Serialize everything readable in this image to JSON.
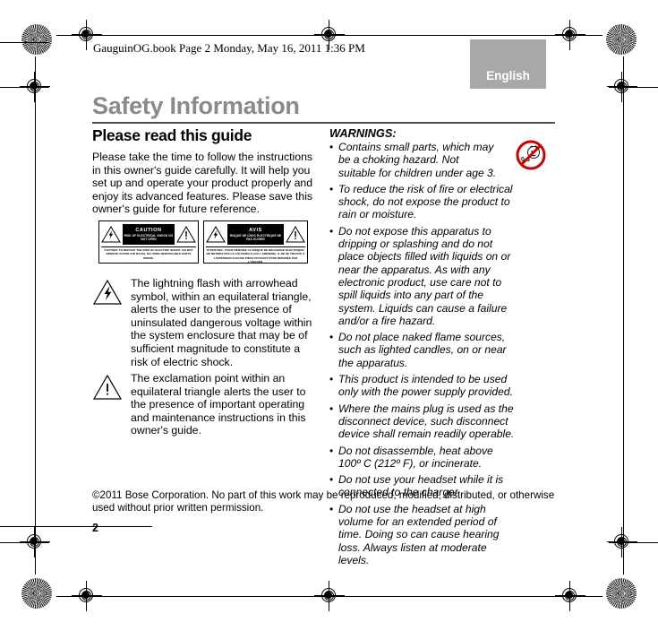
{
  "page_header": "GauguinOG.book  Page 2  Monday, May 16, 2011  1:36 PM",
  "language_tab": "English",
  "document": {
    "title": "Safety Information",
    "page_number": "2",
    "copyright": "©2011 Bose Corporation. No part of this work may be reproduced, modified, distributed, or otherwise used without prior written permission."
  },
  "left_column": {
    "heading": "Please read this guide",
    "intro": "Please take the time to follow the instructions in this owner's guide carefully. It will help you set up and operate your product properly and enjoy its advanced features. Please save this owner's guide for future reference.",
    "notice_boxes": [
      {
        "banner_word": "CAUTION",
        "banner_sub": "RISK OF ELECTRICAL SHOCK DO NOT OPEN",
        "footer": "CAUTION: TO REDUCE THE RISK OF ELECTRIC SHOCK, DO NOT REMOVE COVER (OR BACK), NO USER-SERVICEABLE PARTS INSIDE."
      },
      {
        "banner_word": "AVIS",
        "banner_sub": "RISQUE DE CHOC ELECTRIQUE NE PAS OUVRIR",
        "footer": "ATTENTION : POUR RÉDUIRE LE RISQUE DE DÉCHARGE ÉLECTRIQUE, NE RETIREZ PAS LE COUVERCLE (OU L'ARRIÈRE). IL NE SE TROUVE À L'INTÉRIEUR AUCUNE PIÈCE POUVANT ÊTRE RÉPARÉE PAR L'USAGER."
      }
    ],
    "symbols": [
      {
        "icon": "lightning-bolt-triangle-icon",
        "text": "The lightning flash with arrowhead symbol, within an equilateral triangle, alerts the user to the presence of uninsulated dangerous voltage within the system enclosure that may be of sufficient magnitude to constitute a risk of electric shock."
      },
      {
        "icon": "exclamation-triangle-icon",
        "text": "The exclamation point within an equilateral triangle alerts the user to the presence of important operating and maintenance instructions in this owner's guide."
      }
    ]
  },
  "right_column": {
    "heading": "WARNINGS:",
    "choking_icon_label": "0-3",
    "warnings": [
      "Contains small parts, which may be a choking hazard. Not suitable for children under age 3.",
      "To reduce the risk of fire or electrical shock, do not expose the product to rain or moisture.",
      "Do not expose this apparatus to dripping or splashing and do not place objects filled with liquids on or near the apparatus. As with any electronic product, use care not to spill liquids into any part of the system. Liquids can cause a failure and/or a fire hazard.",
      "Do not place naked flame sources, such as lighted candles, on or near the apparatus.",
      "This product is intended to be used only with the power supply provided.",
      "Where the mains plug is used as the disconnect device, such disconnect device shall remain readily operable.",
      " Do not disassemble, heat above 100º C (212º F), or incinerate.",
      "Do not use your headset while it is connected to the charger.",
      "Do not use the headset at high volume for an extended period of time. Doing so can cause hearing loss. Always listen at moderate levels."
    ]
  },
  "colors": {
    "title_gray": "#8a8a8a",
    "tab_gray": "#a8a8a8",
    "warning_red": "#cc0000"
  }
}
